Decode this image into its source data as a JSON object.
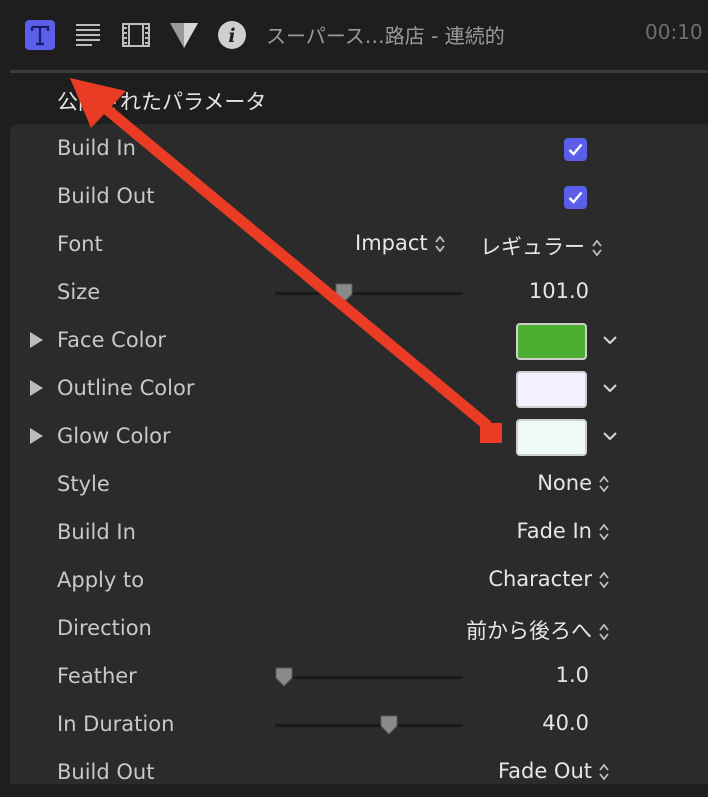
{
  "toolbar": {
    "title": "スーパース…路店 - 連続的",
    "timecode": "00:10"
  },
  "section": {
    "title": "公開されたパラメータ"
  },
  "rows": {
    "build_in": {
      "label": "Build In",
      "checked": true
    },
    "build_out": {
      "label": "Build Out",
      "checked": true
    },
    "font": {
      "label": "Font",
      "family": "Impact",
      "weight": "レギュラー"
    },
    "size": {
      "label": "Size",
      "value": "101.0",
      "slider_fraction": 0.35
    },
    "face_color": {
      "label": "Face Color",
      "color": "#4caf32"
    },
    "outline_color": {
      "label": "Outline Color",
      "color": "#f3f0ff"
    },
    "glow_color": {
      "label": "Glow Color",
      "color": "#eefaf7"
    },
    "style": {
      "label": "Style",
      "value": "None"
    },
    "build_in_effect": {
      "label": "Build In",
      "value": "Fade In"
    },
    "apply_to": {
      "label": "Apply to",
      "value": "Character"
    },
    "direction": {
      "label": "Direction",
      "value": "前から後ろへ"
    },
    "feather": {
      "label": "Feather",
      "value": "1.0",
      "slider_fraction": 0.0
    },
    "in_duration": {
      "label": "In Duration",
      "value": "40.0",
      "slider_fraction": 0.62
    },
    "build_out_effect": {
      "label": "Build Out",
      "value": "Fade Out"
    }
  },
  "colors": {
    "accent": "#5a5ee8",
    "annotation_arrow": "#ea3b24",
    "background": "#1e1e1e",
    "panel": "#2b2b2b"
  },
  "icons": [
    "text-inspector-icon",
    "paragraph-icon",
    "film-icon",
    "shape-icon",
    "info-icon"
  ]
}
